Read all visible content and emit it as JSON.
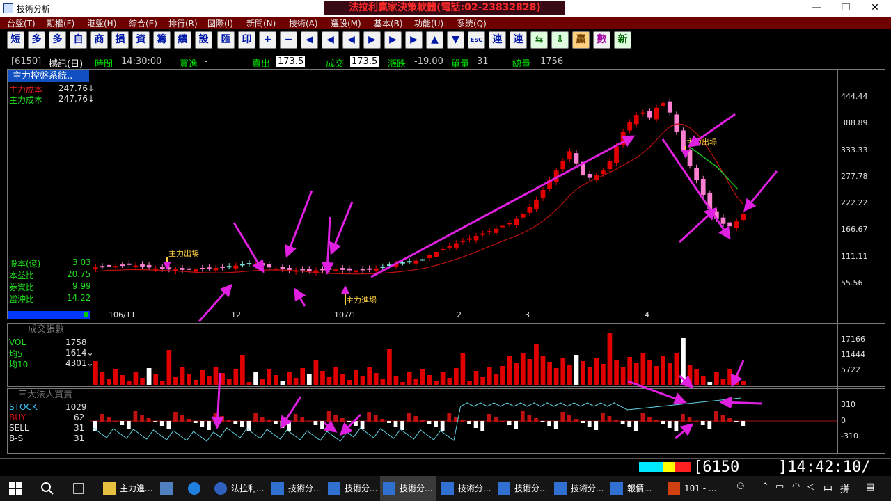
{
  "window": {
    "title": "技術分析",
    "banner": "法拉利贏家決策軟體(電話:02-23832828)",
    "min": "—",
    "max": "❐",
    "close": "✕"
  },
  "menu": [
    "台盤(T)",
    "期權(F)",
    "港盤(H)",
    "綜合(E)",
    "排行(R)",
    "國際(I)",
    "新聞(N)",
    "技術(A)",
    "選股(M)",
    "基本(B)",
    "功能(U)",
    "系統(Q)"
  ],
  "toolbar": {
    "buttons": [
      "短",
      "多",
      "多",
      "自",
      "商",
      "損",
      "資",
      "籌",
      "續",
      "設",
      "匯",
      "印",
      "+",
      "−",
      "◀",
      "◀",
      "◀",
      "▶",
      "▶",
      "▶",
      "▲",
      "▼",
      "ESC",
      "連",
      "連",
      "⇆",
      "⇩",
      "贏",
      "數",
      "新"
    ]
  },
  "quote": {
    "symbol": "[6150]",
    "name": "撼訊(日)",
    "time_label": "時間",
    "time": "14:30:00",
    "bid_label": "買進",
    "bid": "-",
    "ask_label": "賣出",
    "ask": "173.5",
    "trade_label": "成交",
    "trade": "173.5",
    "change_label": "漲跌",
    "change": "-19.00",
    "unit_label": "單量",
    "unit": "31",
    "total_label": "總量",
    "total": "1756"
  },
  "sidebar": {
    "system": "主力控盤系統..",
    "cost1_label": "主力成本",
    "cost1": "247.76↓",
    "cost2_label": "主力成本",
    "cost2": "247.76↓",
    "capital_label": "股本(億)",
    "capital": "3.03",
    "pe_label": "本益比",
    "pe": "20.75",
    "margin_label": "券資比",
    "margin": "9.99",
    "daytrade_label": "當沖比",
    "daytrade": "14.22"
  },
  "volume_panel": {
    "title": "成交張數",
    "vol_label": "VOL",
    "vol": "1758",
    "ma5_label": "均5",
    "ma5": "1614↓",
    "ma10_label": "均10",
    "ma10": "4301↓"
  },
  "inst_panel": {
    "title": "三大法人買賣",
    "stock_label": "STOCK",
    "stock": "1029",
    "buy_label": "BUY",
    "buy": "62",
    "sell_label": "SELL",
    "sell": "31",
    "bs_label": "B-S",
    "bs": "31"
  },
  "annotations": {
    "exit1": "主力出場",
    "entry": "主力進場",
    "exit2": "主力出場"
  },
  "colors": {
    "up": "#e00000",
    "down_pink": "#ff7fd0",
    "flat": "#7fe0d8",
    "arrow": "#e020e0",
    "ma": "#c01010"
  },
  "chart_data": [
    {
      "type": "candlestick",
      "x_ticks": [
        "106/11",
        "12",
        "107/1",
        "2",
        "3",
        "4"
      ],
      "y_ticks": [
        "444.44",
        "388.89",
        "333.33",
        "277.78",
        "222.22",
        "166.67",
        "111.11",
        "55.56"
      ],
      "ylim": [
        0,
        480
      ],
      "closes": [
        80,
        82,
        84,
        83,
        85,
        86,
        84,
        82,
        80,
        78,
        77,
        76,
        76,
        75,
        75,
        76,
        77,
        78,
        79,
        80,
        82,
        84,
        86,
        88,
        86,
        84,
        80,
        78,
        76,
        75,
        74,
        74,
        73,
        74,
        75,
        76,
        76,
        75,
        74,
        74,
        75,
        76,
        78,
        82,
        86,
        88,
        90,
        92,
        94,
        96,
        105,
        112,
        118,
        125,
        130,
        135,
        140,
        145,
        150,
        155,
        160,
        166,
        172,
        180,
        190,
        205,
        220,
        240,
        260,
        280,
        300,
        320,
        295,
        270,
        265,
        270,
        280,
        300,
        330,
        360,
        380,
        395,
        400,
        390,
        410,
        420,
        400,
        360,
        320,
        290,
        260,
        230,
        200,
        180,
        170,
        165,
        175,
        190
      ]
    },
    {
      "type": "bar",
      "y_ticks": [
        "17166",
        "11444",
        "5722"
      ],
      "ylim": [
        0,
        20000
      ]
    },
    {
      "type": "bar-line",
      "y_ticks": [
        "310",
        "0",
        "-310"
      ],
      "ylim": [
        -500,
        500
      ]
    }
  ],
  "statusbar": {
    "code": "[6150",
    "time": "]14:42:10/"
  },
  "taskbar": {
    "items": [
      "主力進...",
      "法拉利...",
      "技術分...",
      "技術分...",
      "技術分...",
      "技術分...",
      "技術分...",
      "技術分...",
      "報價...",
      "101 - ..."
    ],
    "tray_ime": "中",
    "tray_lang": "拼"
  }
}
